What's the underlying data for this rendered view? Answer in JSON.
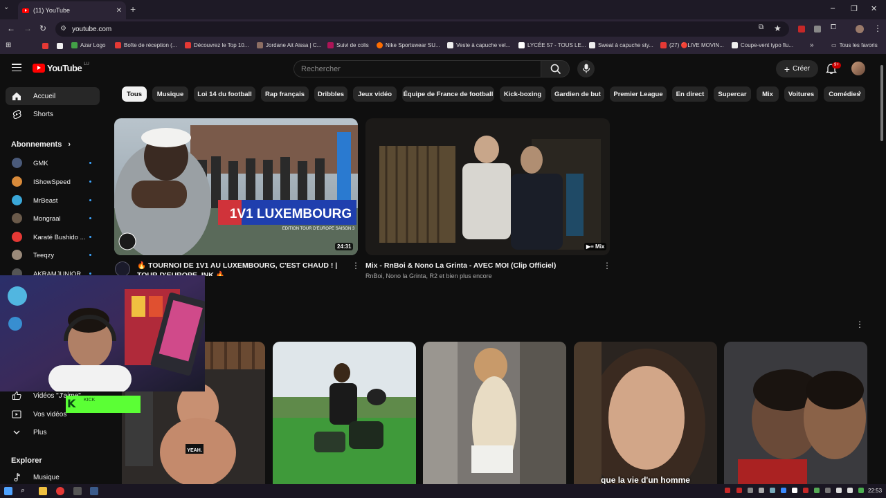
{
  "browser": {
    "tab_title": "(11) YouTube",
    "url": "youtube.com",
    "bookmarks": [
      "Azar Logo",
      "Boîte de réception (...",
      "Découvrez le Top 10...",
      "Jordane Ait Aissa | C...",
      "Suivi de colis",
      "Nike Sportswear SU...",
      "Veste à capuche vel...",
      "LYCÉE 57 - TOUS LE...",
      "Sweat à capuche sty...",
      "(27) 🔴LIVE MOVIN...",
      "Coupe-vent typo flu..."
    ],
    "all_bookmarks": "Tous les favoris"
  },
  "header": {
    "logo_text": "YouTube",
    "logo_region": "LU",
    "search_placeholder": "Rechercher",
    "create_label": "Créer",
    "notif_count": "9+"
  },
  "sidebar": {
    "home": "Accueil",
    "shorts": "Shorts",
    "subs_heading": "Abonnements",
    "channels": [
      {
        "name": "GMK",
        "color": "#4a5a7a"
      },
      {
        "name": "IShowSpeed",
        "color": "#d88a3a"
      },
      {
        "name": "MrBeast",
        "color": "#3aa7d8"
      },
      {
        "name": "Mongraal",
        "color": "#6a5a4a"
      },
      {
        "name": "Karaté Bushido ...",
        "color": "#e53935"
      },
      {
        "name": "Teeqzy",
        "color": "#9a8a7a"
      },
      {
        "name": "AKRAMJUNIOR ...",
        "color": "#555555"
      }
    ],
    "liked_partial": "Vidéos \"J'aime\"",
    "your_videos": "Vos vidéos",
    "more": "Plus",
    "explore_heading": "Explorer",
    "music": "Musique"
  },
  "chips": [
    "Tous",
    "Musique",
    "Loi 14 du football",
    "Rap français",
    "Dribbles",
    "Jeux vidéo",
    "Équipe de France de football",
    "Kick-boxing",
    "Gardien de but",
    "Premier League",
    "En direct",
    "Supercar",
    "Mix",
    "Voitures",
    "Comédies"
  ],
  "videos": [
    {
      "title": "🔥 TOURNOI DE 1V1 AU LUXEMBOURG, C'EST CHAUD ! | TOUR D'EUROPE, INK 🔥",
      "duration": "24:31",
      "thumb_heading": "1V1 LUXEMBOURG",
      "thumb_sub": "EDITION TOUR D'EUROPE SAISON 3",
      "channel_badge": "INK"
    },
    {
      "title": "Mix - RnBoi & Nono La Grinta - AVEC MOI (Clip Officiel)",
      "meta": "RnBoi, Nono la Grinta, R2 et bien plus encore",
      "badge": "Mix"
    }
  ],
  "shorts_row": {
    "caption_4": "que la vie d'un homme",
    "caption_1": "YEAH."
  },
  "webcam": {
    "overlay_letter": "K",
    "overlay_text": "KICK"
  },
  "taskbar": {
    "time": "22:53"
  }
}
